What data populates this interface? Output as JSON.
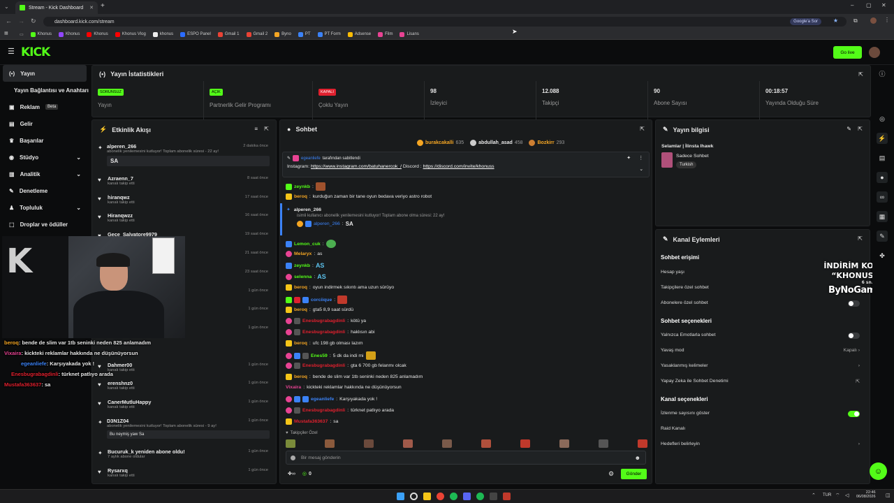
{
  "browser": {
    "tab_title": "Stream - Kick Dashboard",
    "url": "dashboard.kick.com/stream",
    "google_chip": "Google'a Sor",
    "bookmarks": [
      "Khonus",
      "Khonus",
      "Khonus",
      "Khonus Vlog",
      "khonus",
      "ESPO Panel",
      "Gmail 1",
      "Gmail 2",
      "Byno",
      "PT",
      "PT Form",
      "Adsense",
      "Film",
      "Lisans"
    ]
  },
  "header": {
    "logo": "KICK",
    "go_live": "Go live"
  },
  "sidebar": {
    "items": [
      {
        "label": "Yayın",
        "icon": "broadcast-icon"
      },
      {
        "label": "Yayın Bağlantısı ve Anahtarı",
        "icon": ""
      },
      {
        "label": "Reklam",
        "badge": "Beta",
        "icon": "ad-icon"
      },
      {
        "label": "Gelir",
        "icon": "money-icon"
      },
      {
        "label": "Başarılar",
        "icon": "trophy-icon"
      },
      {
        "label": "Stüdyo",
        "icon": "studio-icon"
      },
      {
        "label": "Analitik",
        "icon": "chart-icon"
      },
      {
        "label": "Denetleme",
        "icon": "wrench-icon"
      },
      {
        "label": "Topluluk",
        "icon": "community-icon"
      },
      {
        "label": "Droplar ve ödüller",
        "icon": "gift-icon"
      }
    ]
  },
  "stats": {
    "title": "Yayın İstatistikleri",
    "cells": [
      {
        "tag": "SORUNSUZ",
        "label": "Yayın",
        "tag_color": "#53fc18"
      },
      {
        "tag": "AÇIK",
        "label": "Partnerlik Gelir Programı",
        "tag_color": "#53fc18"
      },
      {
        "tag": "KAPALI",
        "label": "Çoklu Yayın",
        "tag_color": "#e0202e"
      },
      {
        "value": "98",
        "label": "İzleyici"
      },
      {
        "value": "12.088",
        "label": "Takipçi"
      },
      {
        "value": "90",
        "label": "Abone Sayısı"
      },
      {
        "value": "00:18:57",
        "label": "Yayında Olduğu Süre"
      }
    ]
  },
  "activity": {
    "title": "Etkinlik Akışı",
    "events": [
      {
        "name": "alperen_266",
        "sub": "abonelik yenilemesini kutluyor! Toplam abonelik süresi - 22 ay!",
        "time": "2 dakika önce",
        "msg": "SA"
      },
      {
        "name": "Azraenn_7",
        "sub": "kanalı takip etti",
        "time": "8 saat önce"
      },
      {
        "name": "hiranqwz",
        "sub": "kanalı takip etti",
        "time": "17 saat önce"
      },
      {
        "name": "Hiranqwzz",
        "sub": "kanalı takip etti",
        "time": "16 saat önce"
      },
      {
        "name": "Gece_Salvatore9979",
        "sub": "",
        "time": "19 saat önce"
      },
      {
        "name": "",
        "sub": "",
        "time": "21 saat önce"
      },
      {
        "name": "",
        "sub": "",
        "time": "23 saat önce"
      },
      {
        "name": "",
        "sub": "",
        "time": "1 gün önce"
      },
      {
        "name": "",
        "sub": "",
        "time": "1 gün önce"
      },
      {
        "name": "",
        "sub": "",
        "time": "1 gün önce"
      },
      {
        "name": "Dahmer00",
        "sub": "kanalı takip etti",
        "time": "1 gün önce"
      },
      {
        "name": "erenshnz0",
        "sub": "kanalı takip etti",
        "time": "1 gün önce"
      },
      {
        "name": "CanerMutluHappy",
        "sub": "kanalı takip etti",
        "time": "1 gün önce"
      },
      {
        "name": "D3N1Z04",
        "sub": "abonelik yenilemesini kutluyor! Toplam abonelik süresi - 9 ay!",
        "time": "1 gün önce",
        "msg": "Bu neymiş yaw Sa"
      },
      {
        "name": "Bucuruk_k yeniden abone oldu!",
        "sub": "7 aylık abone oldular",
        "time": "1 gün önce"
      },
      {
        "name": "Rysarxq",
        "sub": "kanalı takip etti",
        "time": "1 gün önce"
      }
    ]
  },
  "overlay_chat": [
    {
      "user": "beroq",
      "text": "bende de slim var 1tb seninki neden 825 anlamadım",
      "color": "#f5a623"
    },
    {
      "user": "Vixaira",
      "text": "kickteki reklamlar hakkında ne düşünüyorsun",
      "color": "#e84393"
    },
    {
      "user": "egeanliefe",
      "text": "Karşıyakada yok !",
      "color": "#3b82f6"
    },
    {
      "user": "Enesbugrabagdinli",
      "text": "türknet patlıyo arada",
      "color": "#e0202e"
    },
    {
      "user": "Mustafa363637",
      "text": "sa",
      "color": "#e0202e"
    }
  ],
  "chat": {
    "title": "Sohbet",
    "top_gifters": [
      {
        "name": "burakcakalli",
        "count": "635"
      },
      {
        "name": "abdullah_asad",
        "count": "458"
      },
      {
        "name": "Bozkirr",
        "count": "293"
      }
    ],
    "pinned": {
      "by": "egeanliefe",
      "by_suffix": "tarafından sabitlendi",
      "text": "Instagram: ",
      "link1": "https://www.instagram.com/batuhanercok_/",
      "mid": " Discord : ",
      "link2": "https://discord.com/invite/khonuss"
    },
    "messages": [
      {
        "user": "zeynkb",
        "text": "",
        "color": "#53fc18",
        "emote": true
      },
      {
        "user": "beroq",
        "text": "kurduğun zaman bir tane oyun bedava veriyo astro robot",
        "color": "#f5a623"
      },
      {
        "user": "Lemon_cuk",
        "text": "",
        "color": "#53fc18",
        "emote": true
      },
      {
        "user": "Melaryx",
        "text": "as",
        "color": "#f5a623"
      },
      {
        "user": "zeynkb",
        "text": "AS",
        "color": "#53fc18"
      },
      {
        "user": "selenna",
        "text": "AS",
        "color": "#53fc18"
      },
      {
        "user": "beroq",
        "text": "oyun indirmek sıkıntı ama uzun sürüyo",
        "color": "#f5a623"
      },
      {
        "user": "corciique",
        "text": "",
        "color": "#3b82f6",
        "emote": true
      },
      {
        "user": "beroq",
        "text": "gta5 8,9 saat sürdü",
        "color": "#f5a623"
      },
      {
        "user": "Enesbugrabagdinli",
        "text": "kötü ya",
        "color": "#e0202e"
      },
      {
        "user": "Enesbugrabagdinli",
        "text": "haklısın abi",
        "color": "#e0202e"
      },
      {
        "user": "beroq",
        "text": "ufc 198 gb olması lazım",
        "color": "#f5a623"
      },
      {
        "user": "Enes59",
        "text": "5 dk da indi mi",
        "color": "#3b82f6"
      },
      {
        "user": "Enesbugrabagdinli",
        "text": "gta 6 700 gb felanmı olcak",
        "color": "#e0202e"
      },
      {
        "user": "beroq",
        "text": "bende de slim var 1tb seninki neden 825 anlamadım",
        "color": "#f5a623"
      },
      {
        "user": "Vixaira",
        "text": "kickteki reklamlar hakkında ne düşünüyorsun",
        "color": "#e84393"
      },
      {
        "user": "egeanliefe",
        "text": "Karşıyakada yok !",
        "color": "#3b82f6"
      },
      {
        "user": "Enesbugrabagdinli",
        "text": "türknet patlıyo arada",
        "color": "#e0202e"
      },
      {
        "user": "Mustafa363637",
        "text": "sa",
        "color": "#e0202e"
      }
    ],
    "sub_event": {
      "name": "alperen_266",
      "text": "isimli kullanıcı abonelik yenilemesini kutluyor! Toplam abone olma süresi: 22 ay!",
      "reply_user": "alperen_266",
      "reply": "SA"
    },
    "followers_only": "Takipçiler Özel",
    "placeholder": "Bir mesaj gönderin",
    "send": "Gönder",
    "points": "0"
  },
  "info": {
    "title": "Yayın bilgisi",
    "stream_title": "Selamlar | İlinsta Ihawk",
    "category": "Sadece Sohbet",
    "language": "Turkish"
  },
  "actions": {
    "title": "Kanal Eylemleri",
    "chat_access": "Sohbet erişimi",
    "account_age": "Hesap yaşı",
    "followers_chat": "Takipçilere özel sohbet",
    "subs_chat": "Abonelere özel sohbet",
    "chat_options": "Sohbet seçenekleri",
    "emotes_only": "Yalnızca Emotlarla sohbet",
    "slow_mode": "Yavaş mod",
    "slow_mode_value": "Kapalı",
    "banned_words": "Yasaklanmış kelimeler",
    "ai_mod": "Yapay Zeka ile Sohbet Denetimi",
    "channel_options": "Kanal seçenekleri",
    "show_viewers": "İzlenme sayısını göster",
    "raid": "Raid Kanalı",
    "goals": "Hedefleri belirleyin"
  },
  "promo": {
    "line1": "İNDİRİM KODU",
    "line2": "“KHONUS”",
    "brand": "ByNoGame",
    "mini": "6 sn."
  },
  "taskbar": {
    "lang": "TUR",
    "time": "22:46",
    "date": "06/08/2026"
  },
  "colors": {
    "kick_green": "#53fc18",
    "panel": "#191b1c"
  }
}
